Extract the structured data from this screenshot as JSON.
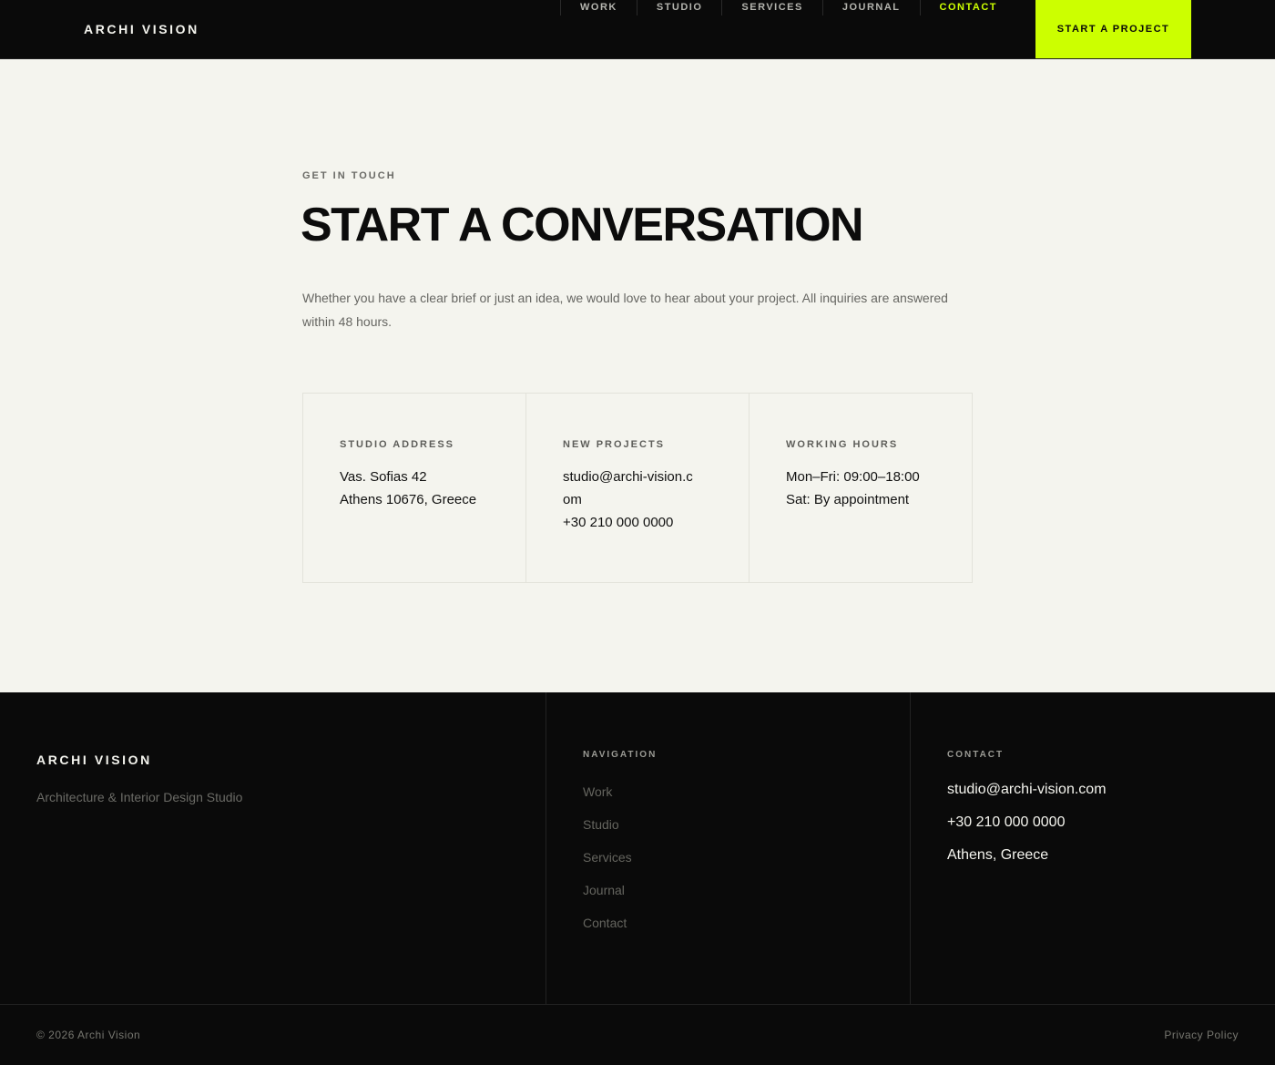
{
  "header": {
    "logo": "ARCHI VISION",
    "nav": [
      {
        "label": "WORK",
        "active": false
      },
      {
        "label": "STUDIO",
        "active": false
      },
      {
        "label": "SERVICES",
        "active": false
      },
      {
        "label": "JOURNAL",
        "active": false
      },
      {
        "label": "CONTACT",
        "active": true
      }
    ],
    "cta": "START A PROJECT"
  },
  "main": {
    "eyebrow": "GET IN TOUCH",
    "title": "START A CONVERSATION",
    "intro": "Whether you have a clear brief or just an idea, we would love to hear about your project. All inquiries are answered within 48 hours.",
    "cards": [
      {
        "label": "STUDIO ADDRESS",
        "lines": [
          "Vas. Sofias 42",
          "Athens 10676, Greece"
        ]
      },
      {
        "label": "NEW PROJECTS",
        "lines": [
          "studio@archi-vision.com",
          "+30 210 000 0000"
        ]
      },
      {
        "label": "WORKING HOURS",
        "lines": [
          "Mon–Fri: 09:00–18:00",
          "Sat: By appointment"
        ]
      }
    ]
  },
  "footer": {
    "logo": "ARCHI VISION",
    "tagline": "Architecture & Interior Design Studio",
    "navigation": {
      "heading": "NAVIGATION",
      "items": [
        "Work",
        "Studio",
        "Services",
        "Journal",
        "Contact"
      ]
    },
    "contact": {
      "heading": "CONTACT",
      "email": "studio@archi-vision.com",
      "phone": "+30 210 000 0000",
      "location": "Athens, Greece"
    },
    "copyright": "© 2026 Archi Vision",
    "privacy": "Privacy Policy"
  },
  "colors": {
    "accent": "#ccff00",
    "dark": "#0a0a0a",
    "light": "#f4f4ee"
  }
}
